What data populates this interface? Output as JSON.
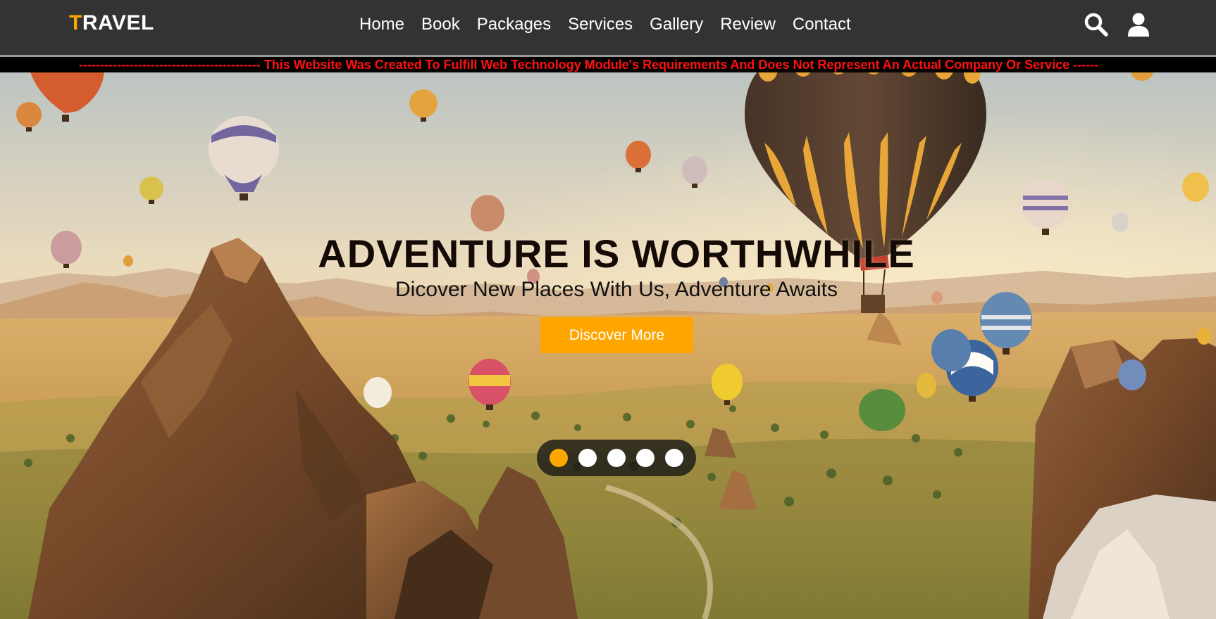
{
  "header": {
    "logo_accent": "T",
    "logo_rest": "RAVEL",
    "nav": [
      "Home",
      "Book",
      "Packages",
      "Services",
      "Gallery",
      "Review",
      "Contact"
    ],
    "icons": [
      "search-icon",
      "user-icon"
    ]
  },
  "notice": {
    "text": "------------------------------------------- This Website Was Created To Fulfill Web Technology Module's Requirements And Does Not Represent An Actual Company Or Service ------"
  },
  "hero": {
    "title": "ADVENTURE IS WORTHWHILE",
    "subtitle": "Dicover New Places With Us, Adventure Awaits",
    "cta_label": "Discover More",
    "slides_count": 5,
    "active_slide": 1
  },
  "colors": {
    "header_bg": "#333333",
    "accent": "#ffa500",
    "notice_text": "#ff1010",
    "notice_bg": "#000000"
  }
}
